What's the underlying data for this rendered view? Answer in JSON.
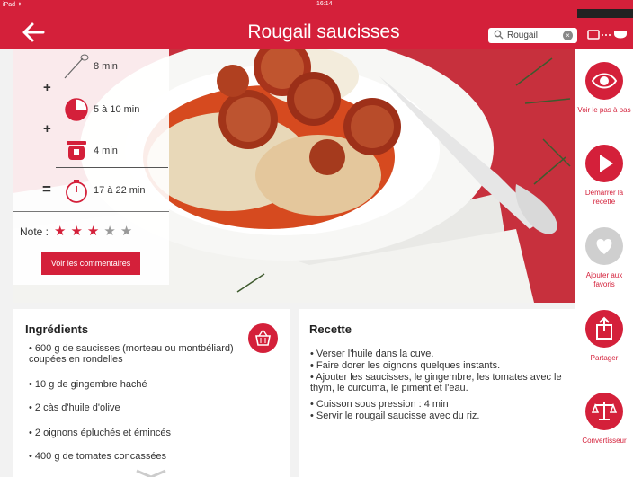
{
  "status": {
    "left": "iPad ✦",
    "time": "16:14"
  },
  "header": {
    "title": "Rougail saucisses",
    "search_value": "Rougail"
  },
  "times": {
    "prep": "8 min",
    "cook": "5 à 10 min",
    "pressure": "4 min",
    "total": "17 à 22 min",
    "plus": "+",
    "equals": "="
  },
  "rating": {
    "label": "Note :",
    "stars_filled": 3,
    "stars_total": 5,
    "star_glyph": "★"
  },
  "comments_button": "Voir les commentaires",
  "rail": {
    "step_by_step": "Voir le pas à pas",
    "start": "Démarrer la recette",
    "favorite": "Ajouter aux favoris",
    "share": "Partager",
    "converter": "Convertisseur"
  },
  "ingredients": {
    "title": "Ingrédients",
    "items": [
      "• 600 g de saucisses (morteau ou montbéliard) coupées en rondelles",
      "• 10 g de gingembre haché",
      "• 2 càs d'huile d'olive",
      "• 2 oignons épluchés et émincés",
      "• 400 g de tomates concassées"
    ]
  },
  "recipe": {
    "title": "Recette",
    "steps": [
      "• Verser l'huile dans la cuve.",
      "• Faire dorer les oignons quelques instants.",
      "• Ajouter les saucisses, le gingembre, les tomates avec le thym, le curcuma, le piment et l'eau.",
      "• Cuisson sous pression : 4 min",
      "• Servir le rougail saucisse avec du riz."
    ]
  },
  "colors": {
    "accent": "#d4203a",
    "background": "#f2f2f2"
  }
}
